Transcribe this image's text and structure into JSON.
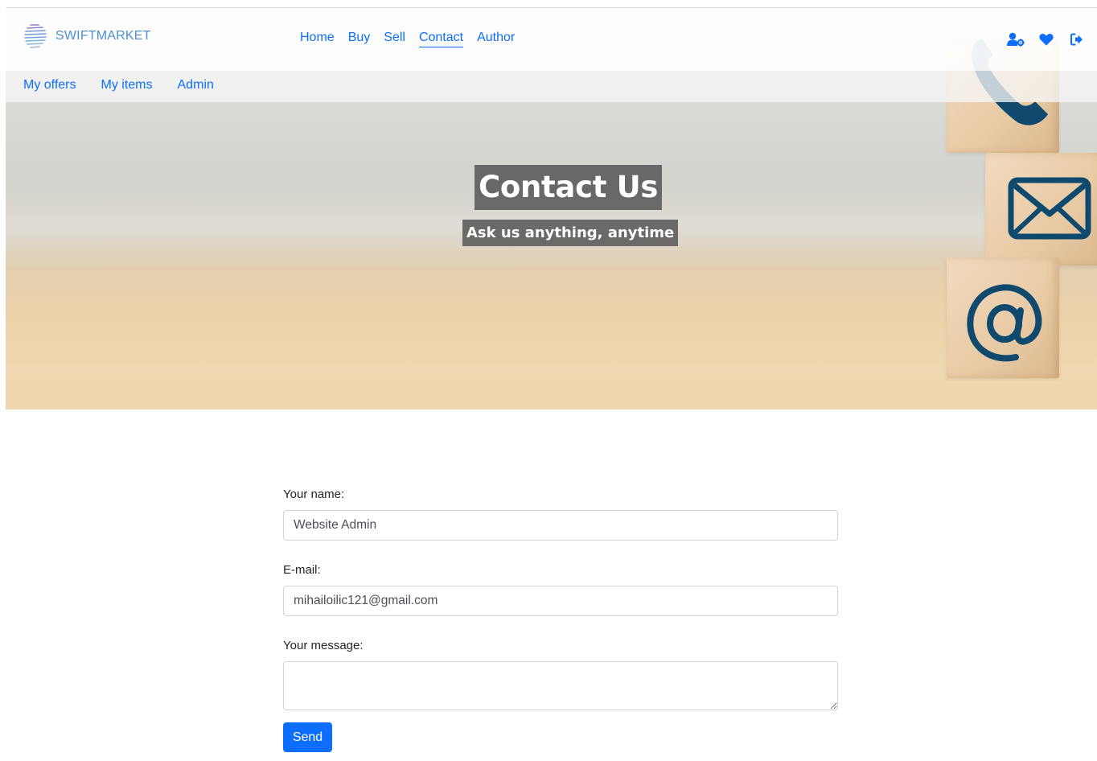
{
  "brand": {
    "name": "SWIFTMARKET",
    "logo_icon": "globe-lines-icon"
  },
  "nav": {
    "main_links": [
      {
        "label": "Home"
      },
      {
        "label": "Buy"
      },
      {
        "label": "Sell"
      },
      {
        "label": "Contact",
        "active": true
      },
      {
        "label": "Author"
      }
    ],
    "sub_links": [
      {
        "label": "My offers"
      },
      {
        "label": "My items"
      },
      {
        "label": "Admin"
      }
    ],
    "icons": [
      "user-cog-icon",
      "heart-icon",
      "logout-icon"
    ]
  },
  "hero": {
    "title": "Contact Us",
    "subtitle": "Ask us anything, anytime",
    "block_icons": [
      "phone-icon",
      "envelope-icon",
      "at-sign-icon"
    ]
  },
  "form": {
    "name_label": "Your name:",
    "name_value": "Website Admin",
    "email_label": "E-mail:",
    "email_value": "mihailoilic121@gmail.com",
    "message_label": "Your message:",
    "message_value": "",
    "send_label": "Send"
  },
  "colors": {
    "accent": "#0d6efd",
    "brand_text": "#4e8fd0",
    "block_icon": "#0f4a6e"
  }
}
